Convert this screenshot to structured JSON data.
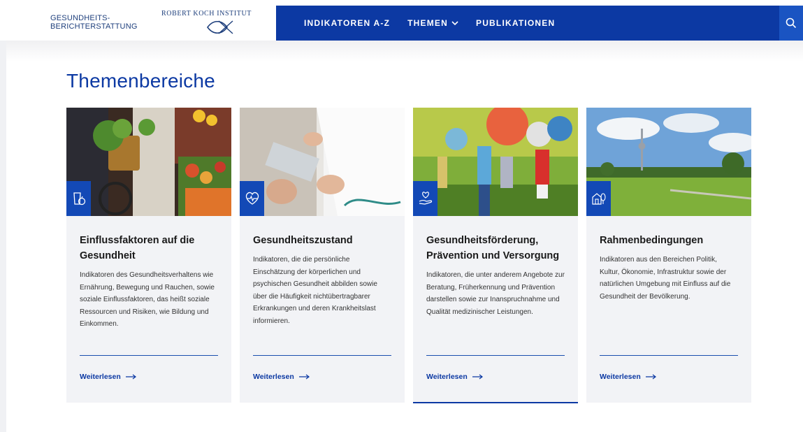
{
  "header": {
    "logo_gbe_line1": "GESUNDHEITS-",
    "logo_gbe_line2": "BERICHTERSTATTUNG",
    "logo_rki": "ROBERT KOCH INSTITUT",
    "nav": [
      {
        "label": "INDIKATOREN A-Z"
      },
      {
        "label": "THEMEN"
      },
      {
        "label": "PUBLIKATIONEN"
      }
    ],
    "icons": {
      "search": "search-icon",
      "themen_dropdown": "chevron-down-icon"
    }
  },
  "colors": {
    "brand_blue": "#0c39a3",
    "search_blue": "#1a54c2",
    "card_bg": "#f2f3f6",
    "icon_tile": "#1349b6"
  },
  "main": {
    "title": "Themenbereiche",
    "cards": [
      {
        "title": "Einflussfaktoren auf die Gesundheit",
        "text": "Indikatoren des Gesundheitsverhaltens wie Ernährung, Bewegung und Rauchen, sowie soziale Einflussfaktoren, das heißt soziale Ressourcen und Risiken, wie Bildung und Einkommen.",
        "link": "Weiterlesen",
        "icon": "food-basket-icon"
      },
      {
        "title": "Gesundheitszustand",
        "text": "Indikatoren, die die persönliche Einschätzung der körperlichen und psychischen Gesundheit abbilden sowie über die Häufigkeit nichtübertragbarer Erkrankungen und deren Krankheitslast informieren.",
        "link": "Weiterlesen",
        "icon": "heart-pulse-icon"
      },
      {
        "title": "Gesundheitsförderung, Prävention und Versorgung",
        "text": "Indikatoren, die unter anderem Angebote zur Beratung, Früherkennung und Prävention darstellen sowie zur Inanspruchnahme und Qualität medizinischer Leistungen.",
        "link": "Weiterlesen",
        "icon": "hand-heart-icon"
      },
      {
        "title": "Rahmenbedingungen",
        "text": "Indikatoren aus den Bereichen Politik, Kultur, Ökonomie, Infrastruktur sowie der natürlichen Umgebung mit Einfluss auf die Gesundheit der Bevölkerung.",
        "link": "Weiterlesen",
        "icon": "house-tree-icon"
      }
    ]
  }
}
